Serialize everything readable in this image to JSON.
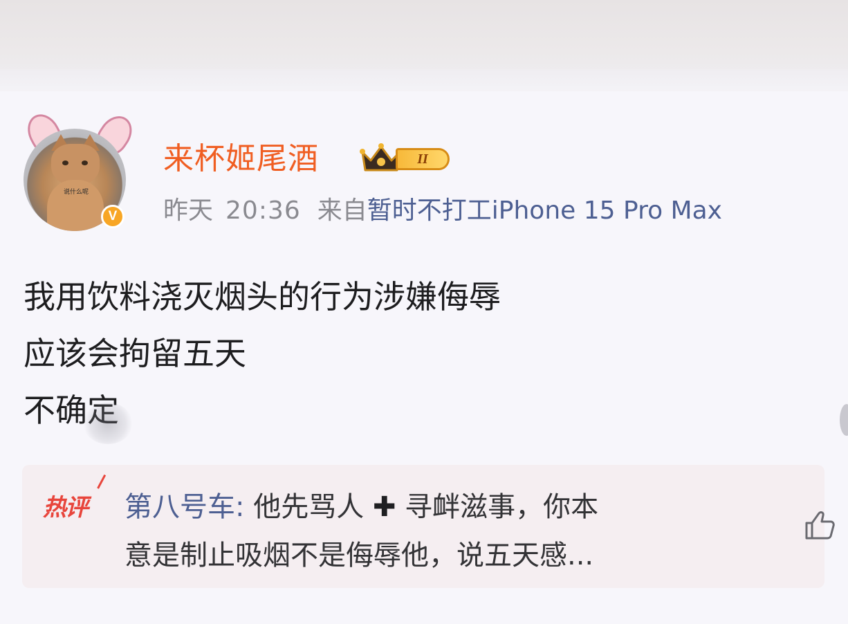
{
  "post": {
    "username": "来杯姬尾酒",
    "vip_level": "II",
    "date": "昨天",
    "time": "20:36",
    "source_prefix": "来自",
    "source": "暂时不打工iPhone 15 Pro Max",
    "body_lines": [
      "我用饮料浇灭烟头的行为涉嫌侮辱",
      "应该会拘留五天",
      "不确定"
    ],
    "avatar_caption": "说什么呢"
  },
  "hot_comment": {
    "label": "热评",
    "commenter": "第八号车:",
    "line1_before": " 他先骂人 ",
    "plus": "✚",
    "line1_after": " 寻衅滋事，你本",
    "line2": "意是制止吸烟不是侮辱他，说五天感..."
  },
  "icons": {
    "verified": "verified-v-icon",
    "crown": "crown-icon",
    "like": "thumbs-up-icon"
  },
  "colors": {
    "username": "#f05e22",
    "link": "#4d5f92",
    "hot_label": "#e8453c",
    "verified": "#f8a625"
  }
}
